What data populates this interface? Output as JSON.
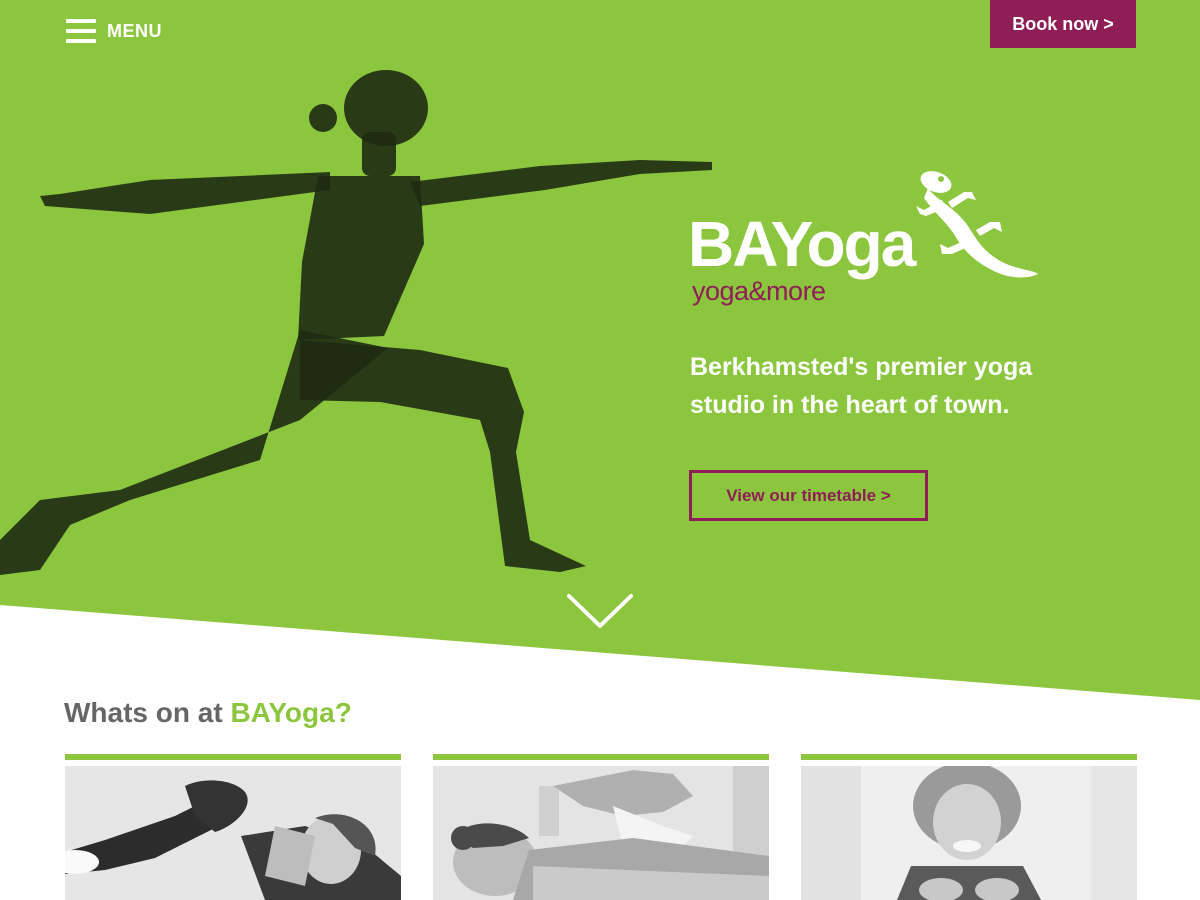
{
  "nav": {
    "menu_label": "MENU",
    "book_now_label": "Book now >"
  },
  "logo": {
    "wordmark": "BAYoga",
    "tagline": "yoga&more"
  },
  "hero": {
    "tagline": "Berkhamsted's premier yoga studio in the heart of town.",
    "cta_label": "View our timetable >"
  },
  "whats_on": {
    "title_prefix": "Whats on at ",
    "title_brand": "BAYoga?"
  },
  "colors": {
    "brand_green": "#8cc63f",
    "brand_purple": "#8e1e55",
    "heading_grey": "#666666",
    "white": "#ffffff"
  },
  "icons": [
    "menu-icon",
    "gecko-icon",
    "chevron-down-icon"
  ]
}
